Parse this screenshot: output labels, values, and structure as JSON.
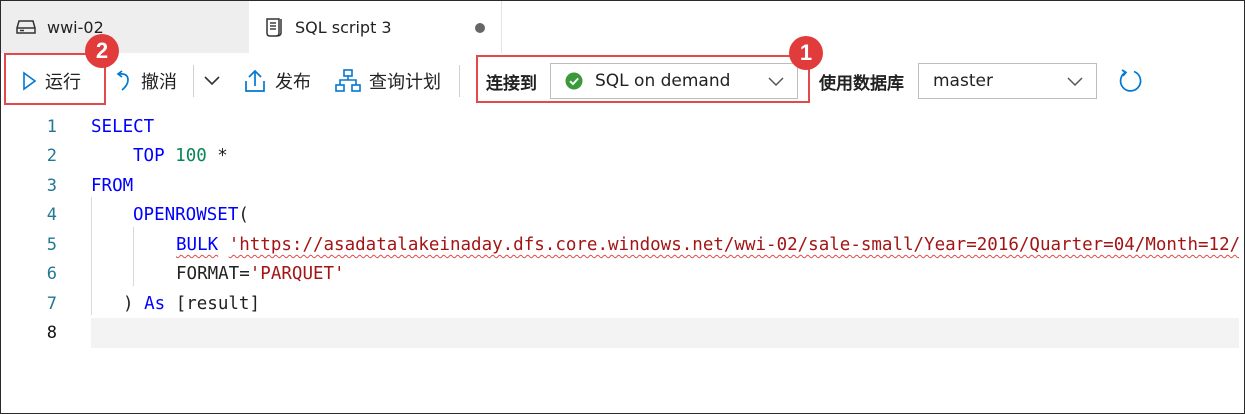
{
  "tabs": [
    {
      "label": "wwi-02",
      "icon": "storage-icon"
    },
    {
      "label": "SQL script 3",
      "icon": "script-icon",
      "dirty": true
    }
  ],
  "toolbar": {
    "run_label": "运行",
    "undo_label": "撤消",
    "publish_label": "发布",
    "query_plan_label": "查询计划",
    "connect_label": "连接到",
    "connect_value": "SQL on demand",
    "database_label": "使用数据库",
    "database_value": "master"
  },
  "annotations": {
    "badge_1": "1",
    "badge_2": "2"
  },
  "editor": {
    "line_numbers": [
      "1",
      "2",
      "3",
      "4",
      "5",
      "6",
      "7",
      "8"
    ],
    "lines": [
      {
        "kw1": "SELECT"
      },
      {
        "kw1": "TOP",
        "num": "100",
        "rest": " *"
      },
      {
        "kw1": "FROM"
      },
      {
        "kw1": "OPENROWSET",
        "rest": "("
      },
      {
        "kw1": "BULK",
        "str": "'https://asadatalakeinaday.dfs.core.windows.net/wwi-02/sale-small/Year=2016/Quarter=04/Month=12/"
      },
      {
        "plain": "FORMAT=",
        "str": "'PARQUET'"
      },
      {
        "plain": ") ",
        "kw1": "As",
        "rest": " [result]"
      },
      {}
    ]
  },
  "colors": {
    "keyword": "#0000ff",
    "number": "#098658",
    "string": "#a31515",
    "line_number": "#237893",
    "highlight": "#e04a4a",
    "status_ok": "#3a9a3a",
    "accent": "#0078d4"
  }
}
